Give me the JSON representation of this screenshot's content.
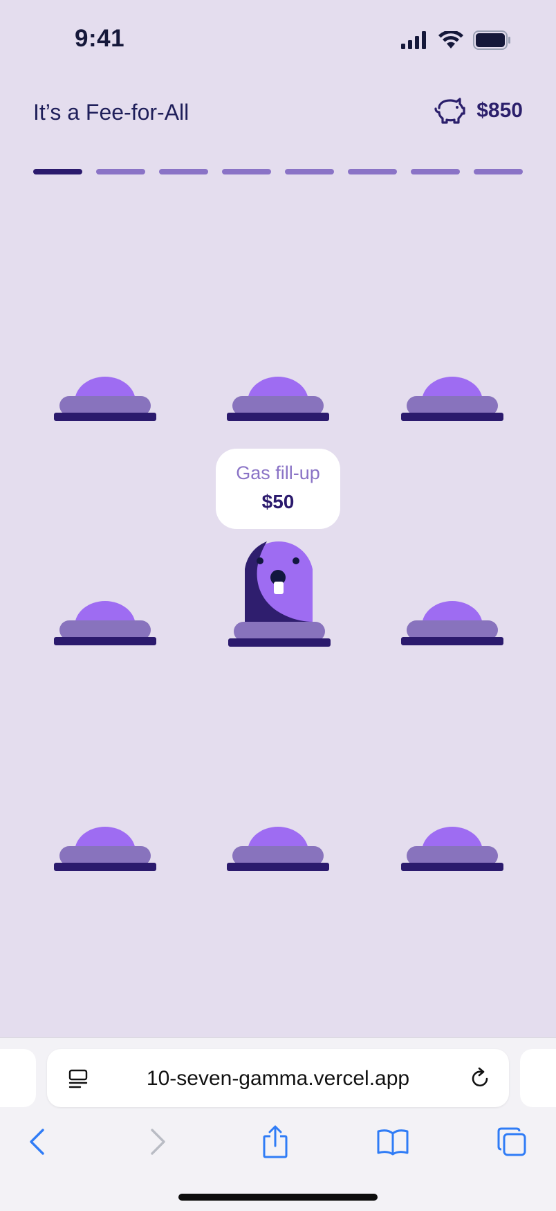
{
  "status_bar": {
    "time": "9:41"
  },
  "header": {
    "title": "It’s a Fee-for-All",
    "balance": "$850"
  },
  "progress": {
    "total_steps": 8,
    "current_step": 1
  },
  "game": {
    "tooltip_label": "Gas fill-up",
    "tooltip_amount": "$50"
  },
  "browser": {
    "url": "10-seven-gamma.vercel.app"
  },
  "colors": {
    "background": "#e4ddee",
    "accent_dark": "#2b1a6d",
    "accent_mid": "#8a73c6",
    "mound_top": "#9e6cf2",
    "mole_body": "#9e6cf2",
    "mole_shadow": "#2f1e6e"
  },
  "icons": {
    "balance": "piggy-bank-icon",
    "signal": "cellular-signal-icon",
    "wifi": "wifi-icon",
    "battery": "battery-icon"
  }
}
